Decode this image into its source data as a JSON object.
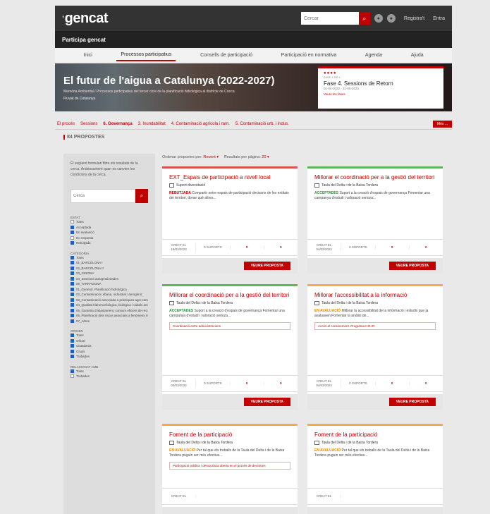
{
  "header": {
    "brand_prefix": "’",
    "brand_name": "gencat",
    "search_placeholder": "Cercar",
    "search_button": "⌕",
    "lang_icon_1": "●",
    "lang_icon_2": "●",
    "register": "Registra't",
    "login": "Entra"
  },
  "subbar": {
    "title": "Participa gencat"
  },
  "nav": {
    "items": [
      "Inici",
      "Processos participatius",
      "Consells de participació",
      "Participació en normativa",
      "Agenda",
      "Ajuda"
    ],
    "active_index": 1
  },
  "hero": {
    "title": "El futur de l'aigua a Catalunya (2022-2027)",
    "subtitle": "Memòria Ambiental / Processos participatius del tercer cicle de la planificació hidrològica al districte de Conca",
    "scope": "Fluvial de Catalunya",
    "phase_dots": "●●●●",
    "phase_small": "FASE 4 DE 4",
    "phase_title": "Fase 4. Sessions de Retorn",
    "phase_dates": "01-04-2022 - 31-05-2022",
    "phase_link": "Veure les fases"
  },
  "categories": {
    "items": [
      "El procés",
      "Sessions",
      "6. Governança",
      "3. Inundabilitat",
      "4. Contaminació agrícola i ram.",
      "5. Contaminació urb. i indus."
    ],
    "active_index": 2,
    "more_button": "Més ..."
  },
  "proposal_count": "84 PROPOSTES",
  "sidebar": {
    "help_text": "El següent formulari filtra els resultats de la cerca. Anàriosament quan es canvien les condicions de la cerca.",
    "search_placeholder": "Cerca",
    "search_icon": "⌕",
    "groups": [
      {
        "title": "ESTAT",
        "options": [
          {
            "label": "Totes",
            "checked": false
          },
          {
            "label": "Acceptada",
            "checked": true
          },
          {
            "label": "En avaluació",
            "checked": true
          },
          {
            "label": "No respesta",
            "checked": false
          },
          {
            "label": "Rebutjada",
            "checked": true
          }
        ]
      },
      {
        "title": "CATEGORIA",
        "options": [
          {
            "label": "Totes",
            "checked": true
          },
          {
            "label": "01_BARCELONA I",
            "checked": true
          },
          {
            "label": "02_BARCELONA II",
            "checked": true
          },
          {
            "label": "03_GIRONA",
            "checked": true
          },
          {
            "label": "04_Sessions autogestionades",
            "checked": true
          },
          {
            "label": "05_TARRAGONA",
            "checked": true
          },
          {
            "label": "01_General. Planificació hidrològica",
            "checked": true
          },
          {
            "label": "02_Contaminació urbana, industrial i aerogènic",
            "checked": true
          },
          {
            "label": "03_Contaminació associada a pràctiques agro-ramaderes",
            "checked": true
          },
          {
            "label": "04_Qualitat hidromorfològica, biològica i cabals ambientals",
            "checked": true
          },
          {
            "label": "05_Garantia d'abastament, consum eficient de recursos",
            "checked": true
          },
          {
            "label": "06_Planificació dels riscos associats a fenòmens meteorològics extrems",
            "checked": true
          },
          {
            "label": "07_Altres",
            "checked": true
          }
        ]
      },
      {
        "title": "ORIGEN",
        "options": [
          {
            "label": "Totes",
            "checked": true
          },
          {
            "label": "Oficial",
            "checked": true
          },
          {
            "label": "Ciutadania",
            "checked": true
          },
          {
            "label": "Grups",
            "checked": true
          },
          {
            "label": "Trobades",
            "checked": true
          }
        ]
      },
      {
        "title": "RELACIONAT AMB",
        "options": [
          {
            "label": "Totes",
            "checked": true
          },
          {
            "label": "Trobades",
            "checked": false
          }
        ]
      }
    ]
  },
  "sort": {
    "order_label": "Ordenar propostes per:",
    "order_value": "Recent ▾",
    "per_page_label": "Resultats per pàgina:",
    "per_page_value": "20 ▾"
  },
  "cards": [
    {
      "status_class": "red",
      "title": "EXT_Espais de participació a nivell local",
      "author": "Suport diversitació",
      "status": "REBUTJADA",
      "text": "Compartir entre espais de participació decisoris de les entitats del territori, donar què altres...",
      "tag": "",
      "created_label": "CREAT EL",
      "created": "18/03/2022",
      "supports": "0 SUPORTS",
      "comments": "0",
      "endorse": "0",
      "button": "VEURE PROPOSTA"
    },
    {
      "status_class": "green",
      "title": "Millorar el coordinació per a la gestió del territori",
      "author": "Taula del Delta i de la Baixa Tordera",
      "status": "ACCEPTADES",
      "text": "Suport a la creació d'espais de governança Fomentar una campanya d'estudi i valoració serioza...",
      "tag": "",
      "created_label": "CREAT EL",
      "created": "04/03/2022",
      "supports": "0 SUPORTS",
      "comments": "0",
      "endorse": "0",
      "button": "VEURE PROPOSTA"
    },
    {
      "status_class": "green",
      "title": "Millorar el coordinació per a la gestió del territori",
      "author": "Taula del Delta i de la Baixa Tordera",
      "status": "ACCEPTADES",
      "text": "Suport a la creació d'espais de governança Fomentar una campanya d'estudi i valoració serioza...",
      "tag": "Coordinació entre administracions",
      "created_label": "CREAT EL",
      "created": "04/03/2022",
      "supports": "0 SUPORTS",
      "comments": "0",
      "endorse": "0",
      "button": "VEURE PROPOSTA"
    },
    {
      "status_class": "orange",
      "title": "Millorar l'accessibilitat a la informació",
      "author": "Taula del Delta i de la Baixa Tordera",
      "status": "EN AVALUACIÓ",
      "text": "Millorar la accessibilitat de la informació i estudis que ja avaluaven Fomentar la anàlisi de...",
      "tag": "Accés al coneixement. Programa I+D+R",
      "created_label": "CREAT EL",
      "created": "04/03/2022",
      "supports": "0 SUPORTS",
      "comments": "0",
      "endorse": "0",
      "button": "VEURE PROPOSTA"
    },
    {
      "status_class": "orange",
      "title": "Foment de la participació",
      "author": "Taula del Delta i de la Baixa Tordera",
      "status": "EN AVALUACIÓ",
      "text": "Per tal que els treballs de la Taula del Delta i de la Baixa Tordera puguin ser més efectius...",
      "tag": "Participació pública i democràcia oberta en el procés de decisions",
      "created_label": "CREAT EL",
      "created": "",
      "supports": "",
      "comments": "",
      "endorse": "",
      "button": ""
    },
    {
      "status_class": "orange",
      "title": "Foment de la participació",
      "author": "Taula del Delta i de la Baixa Tordera",
      "status": "EN AVALUACIÓ",
      "text": "Per tal que els treballs de la Taula del Delta i de la Baixa Tordera puguin ser més efectius...",
      "tag": "",
      "created_label": "CREAT EL",
      "created": "",
      "supports": "",
      "comments": "",
      "endorse": "",
      "button": ""
    }
  ]
}
